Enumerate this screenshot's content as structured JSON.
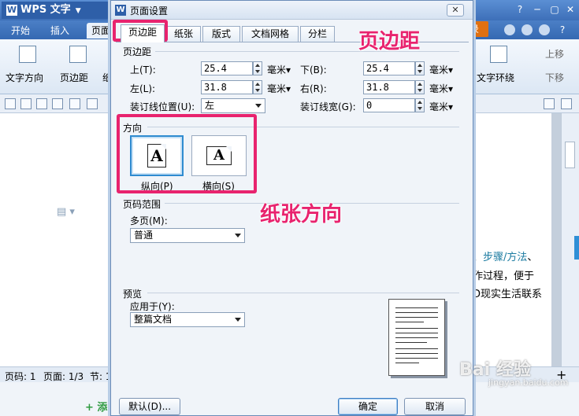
{
  "app": {
    "name": "WPS 文字",
    "tabs": [
      "开始",
      "插入",
      "页面"
    ],
    "login_label": "录",
    "ribbon_left": [
      "文字方向",
      "页边距"
    ],
    "ribbon_left_partial": "纸",
    "ribbon_right": [
      "上移",
      "下移"
    ],
    "ribbon_right_label": "文字环绕",
    "doc_lines": [
      "、步骤/方法、",
      "作过程，便于",
      "D现实生活联系"
    ],
    "doc_link": "步骤/方法",
    "status": {
      "page_code": "页码: 1",
      "page": "页面: 1/3",
      "section": "节: 1"
    },
    "add_label": "+ 添"
  },
  "dialog": {
    "title": "页面设置",
    "close_label": "✕",
    "tabs": [
      {
        "label": "页边距",
        "active": true
      },
      {
        "label": "纸张",
        "active": false
      },
      {
        "label": "版式",
        "active": false
      },
      {
        "label": "文档网格",
        "active": false
      },
      {
        "label": "分栏",
        "active": false
      }
    ],
    "margins": {
      "group_title": "页边距",
      "top": {
        "label": "上(T):",
        "value": "25.4",
        "unit": "毫米"
      },
      "bottom": {
        "label": "下(B):",
        "value": "25.4",
        "unit": "毫米"
      },
      "left": {
        "label": "左(L):",
        "value": "31.8",
        "unit": "毫米"
      },
      "right": {
        "label": "右(R):",
        "value": "31.8",
        "unit": "毫米"
      },
      "gutter_pos": {
        "label": "装订线位置(U):",
        "value": "左"
      },
      "gutter_width": {
        "label": "装订线宽(G):",
        "value": "0",
        "unit": "毫米"
      }
    },
    "orientation": {
      "group_title": "方向",
      "portrait": {
        "label": "纵向(P)",
        "glyph": "A",
        "selected": true
      },
      "landscape": {
        "label": "横向(S)",
        "glyph": "A",
        "selected": false
      }
    },
    "page_range": {
      "group_title": "页码范围",
      "multi_label": "多页(M):",
      "multi_value": "普通"
    },
    "preview": {
      "group_title": "预览",
      "apply_label": "应用于(Y):",
      "apply_value": "整篇文档"
    },
    "buttons": {
      "default": "默认(D)...",
      "ok": "确定",
      "cancel": "取消"
    }
  },
  "annotations": {
    "margin_note": "页边距",
    "orientation_note": "纸张方向",
    "accent_color": "#e8236e"
  },
  "watermark": {
    "text": "Bai 经验",
    "url": "jingyan.baidu.com"
  }
}
